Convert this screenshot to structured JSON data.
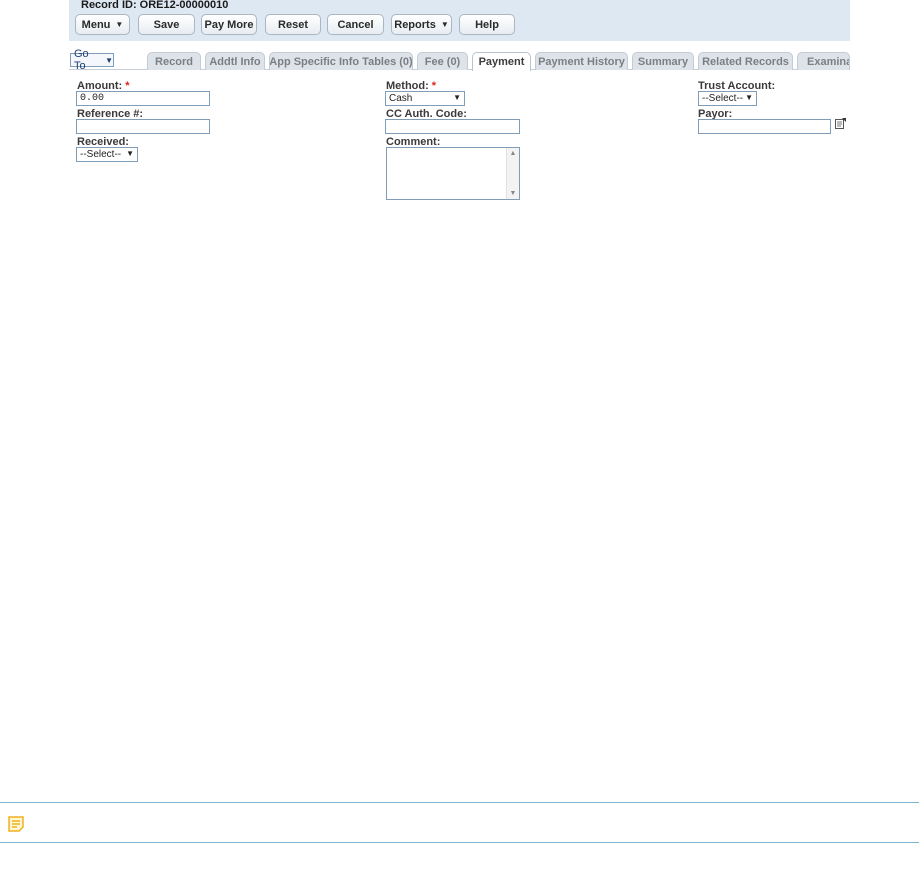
{
  "header": {
    "record_id": "Record ID: ORE12-00000010",
    "toolbar": {
      "menu": "Menu",
      "save": "Save",
      "pay_more": "Pay More",
      "reset": "Reset",
      "cancel": "Cancel",
      "reports": "Reports",
      "help": "Help"
    }
  },
  "nav": {
    "goto": "Go To",
    "tabs": [
      {
        "label": "Record"
      },
      {
        "label": "Addtl Info"
      },
      {
        "label": "App Specific Info Tables (0)"
      },
      {
        "label": "Fee (0)"
      },
      {
        "label": "Payment",
        "active": true
      },
      {
        "label": "Payment History"
      },
      {
        "label": "Summary"
      },
      {
        "label": "Related Records"
      },
      {
        "label": "Examinat"
      }
    ]
  },
  "form": {
    "amount_label": "Amount:",
    "amount_value": "0.00",
    "reference_label": "Reference #:",
    "reference_value": "",
    "received_label": "Received:",
    "received_value": "--Select--",
    "method_label": "Method:",
    "method_value": "Cash",
    "cc_auth_label": "CC Auth. Code:",
    "cc_auth_value": "",
    "comment_label": "Comment:",
    "comment_value": "",
    "trust_account_label": "Trust Account:",
    "trust_account_value": "--Select--",
    "payor_label": "Payor:",
    "payor_value": "",
    "required_marker": "*"
  },
  "colors": {
    "header_bg": "#dde8f3",
    "required": "#dd2222",
    "note_rule": "#7fb3cf",
    "note_icon": "#f2b01e"
  },
  "icons": [
    "caret-down-icon",
    "lookup-icon",
    "note-icon",
    "scroll-up-icon",
    "scroll-down-icon"
  ]
}
